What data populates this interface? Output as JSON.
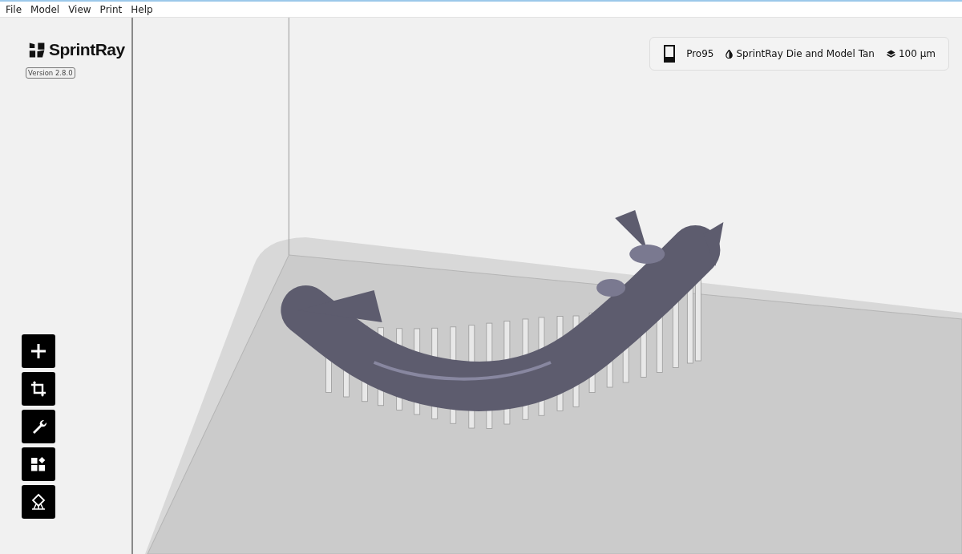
{
  "menu": [
    "File",
    "Model",
    "View",
    "Print",
    "Help"
  ],
  "logo": {
    "text": "SprintRay"
  },
  "version": "Version 2.8.0",
  "print_settings": [
    {
      "kind": "printer",
      "label": "Pro95"
    },
    {
      "kind": "resin",
      "label": "SprintRay Die and Model Tan"
    },
    {
      "kind": "layer",
      "label": "100 µm"
    }
  ],
  "tools": [
    {
      "kind": "add"
    },
    {
      "kind": "crop"
    },
    {
      "kind": "wrench"
    },
    {
      "kind": "arrange"
    },
    {
      "kind": "support"
    }
  ]
}
